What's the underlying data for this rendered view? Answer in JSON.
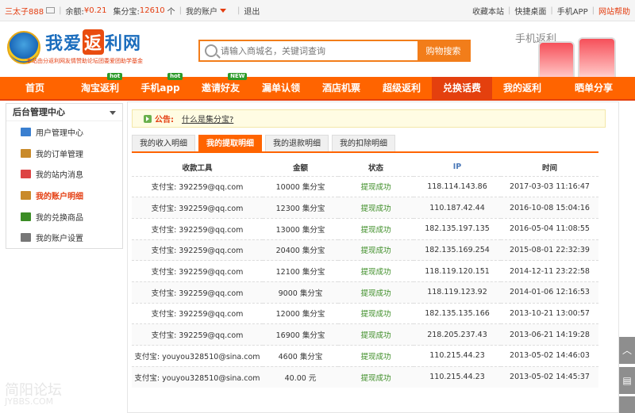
{
  "topbar": {
    "username": "三太子888",
    "balance_label": "余额:",
    "balance": "¥0.21",
    "points_label": "集分宝:",
    "points": "12610",
    "points_unit": "个",
    "my_account": "我的账户",
    "logout": "退出",
    "bookmark": "收藏本站",
    "desktop": "快捷桌面",
    "app": "手机APP",
    "help": "网站帮助"
  },
  "header": {
    "logo_a": "我爱",
    "logo_b": "返",
    "logo_c": "利网",
    "logo_sub": "本站由分返利网友情赞助论坛团委爱团助学基金",
    "search_placeholder": "请输入商城名，关键词查询",
    "search_button": "购物搜索",
    "app_promo_title": "手机返利"
  },
  "nav": [
    {
      "label": "首页",
      "badge": ""
    },
    {
      "label": "淘宝返利",
      "badge": "hot"
    },
    {
      "label": "手机app",
      "badge": "hot"
    },
    {
      "label": "邀请好友",
      "badge": "NEW"
    },
    {
      "label": "漏单认领",
      "badge": ""
    },
    {
      "label": "酒店机票",
      "badge": ""
    },
    {
      "label": "超级返利",
      "badge": ""
    },
    {
      "label": "兑换话费",
      "badge": ""
    },
    {
      "label": "我的返利",
      "badge": ""
    },
    {
      "label": "晒单分享",
      "badge": ""
    }
  ],
  "sidebar": {
    "title": "后台管理中心",
    "items": [
      {
        "label": "用户管理中心",
        "icon": "monitor-icon",
        "color": "#3a7fd0"
      },
      {
        "label": "我的订单管理",
        "icon": "document-icon",
        "color": "#c98a2a"
      },
      {
        "label": "我的站内消息",
        "icon": "message-icon",
        "color": "#d44"
      },
      {
        "label": "我的账户明细",
        "icon": "wallet-icon",
        "color": "#c98a2a"
      },
      {
        "label": "我的兑换商品",
        "icon": "gift-icon",
        "color": "#3b8c24"
      },
      {
        "label": "我的账户设置",
        "icon": "settings-icon",
        "color": "#777"
      }
    ]
  },
  "notice": {
    "label": "公告:",
    "link": "什么是集分宝?"
  },
  "tabs": [
    "我的收入明细",
    "我的提取明细",
    "我的退款明细",
    "我的扣除明细"
  ],
  "table": {
    "headers": [
      "收款工具",
      "金额",
      "状态",
      "IP",
      "时间"
    ],
    "rows": [
      [
        "支付宝: 392259@qq.com",
        "10000 集分宝",
        "提现成功",
        "118.114.143.86",
        "2017-03-03 11:16:47"
      ],
      [
        "支付宝: 392259@qq.com",
        "12300 集分宝",
        "提现成功",
        "110.187.42.44",
        "2016-10-08 15:04:16"
      ],
      [
        "支付宝: 392259@qq.com",
        "13000 集分宝",
        "提现成功",
        "182.135.197.135",
        "2016-05-04 11:08:55"
      ],
      [
        "支付宝: 392259@qq.com",
        "20400 集分宝",
        "提现成功",
        "182.135.169.254",
        "2015-08-01 22:32:39"
      ],
      [
        "支付宝: 392259@qq.com",
        "12100 集分宝",
        "提现成功",
        "118.119.120.151",
        "2014-12-11 23:22:58"
      ],
      [
        "支付宝: 392259@qq.com",
        "9000 集分宝",
        "提现成功",
        "118.119.123.92",
        "2014-01-06 12:16:53"
      ],
      [
        "支付宝: 392259@qq.com",
        "12000 集分宝",
        "提现成功",
        "182.135.135.166",
        "2013-10-21 13:00:57"
      ],
      [
        "支付宝: 392259@qq.com",
        "16900 集分宝",
        "提现成功",
        "218.205.237.43",
        "2013-06-21 14:19:28"
      ],
      [
        "支付宝: youyou328510@sina.com",
        "4600 集分宝",
        "提现成功",
        "110.215.44.23",
        "2013-05-02 14:46:03"
      ],
      [
        "支付宝: youyou328510@sina.com",
        "40.00 元",
        "提现成功",
        "110.215.44.23",
        "2013-05-02 14:45:37"
      ]
    ]
  },
  "watermark": {
    "line1": "简阳论坛",
    "line2": "JYBBS.COM"
  }
}
